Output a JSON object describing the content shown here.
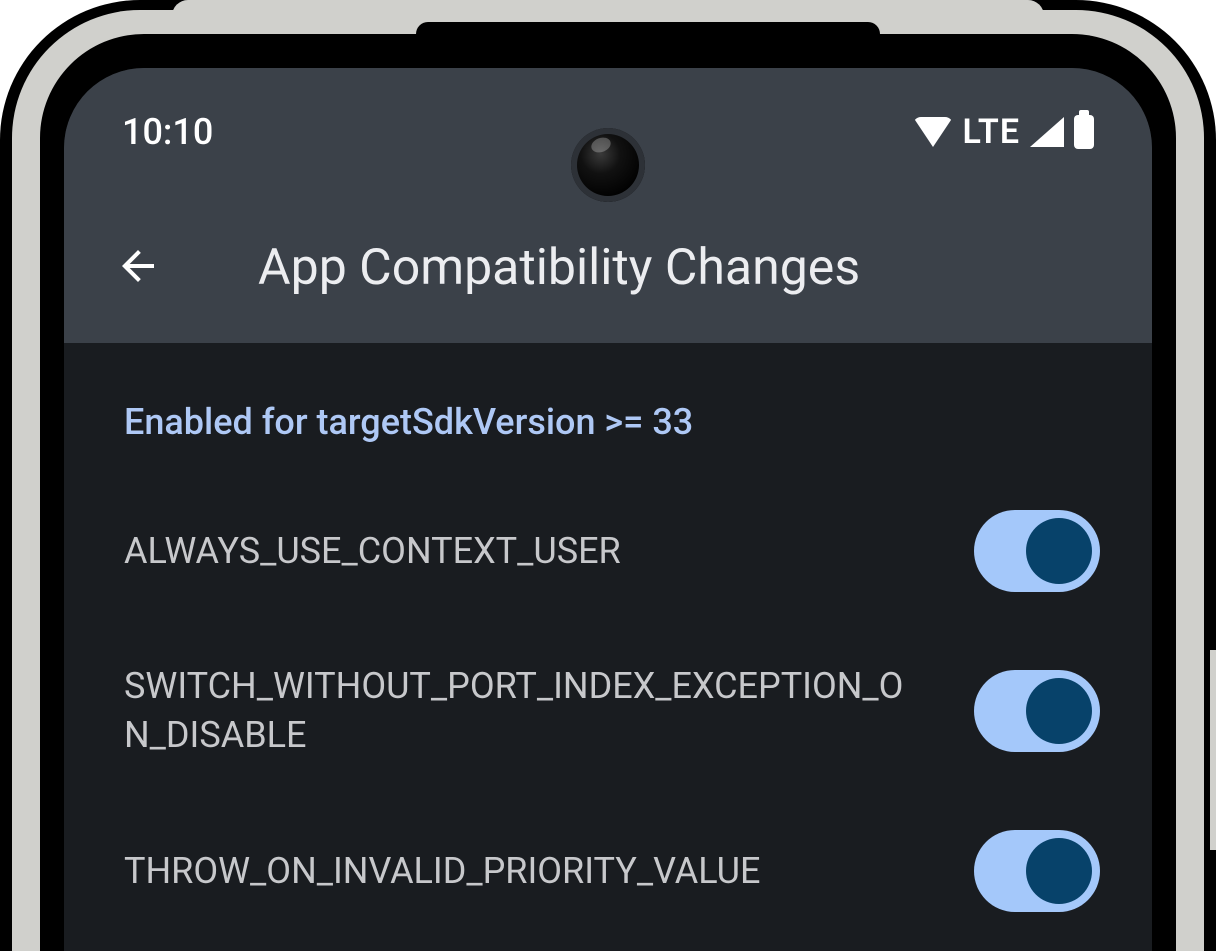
{
  "status": {
    "time": "10:10",
    "network_label": "LTE"
  },
  "appbar": {
    "title": "App Compatibility Changes"
  },
  "content": {
    "section_header": "Enabled for targetSdkVersion >= 33",
    "items": [
      {
        "label": "ALWAYS_USE_CONTEXT_USER",
        "enabled": true
      },
      {
        "label": "SWITCH_WITHOUT_PORT_INDEX_EXCEPTION_ON_DISABLE",
        "enabled": true
      },
      {
        "label": "THROW_ON_INVALID_PRIORITY_VALUE",
        "enabled": true
      }
    ]
  }
}
